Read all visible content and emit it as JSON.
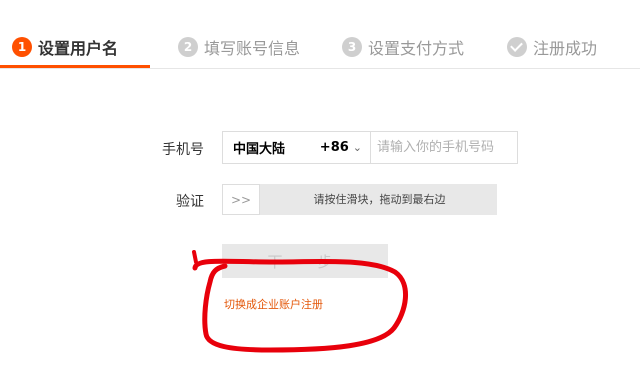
{
  "steps": [
    {
      "num": "1",
      "label": "设置用户名",
      "state": "active"
    },
    {
      "num": "2",
      "label": "填写账号信息",
      "state": "pending"
    },
    {
      "num": "3",
      "label": "设置支付方式",
      "state": "pending"
    },
    {
      "icon": "check-icon",
      "label": "注册成功",
      "state": "pending"
    }
  ],
  "form": {
    "phone_label": "手机号",
    "region": "中国大陆",
    "country_code": "+86",
    "phone_placeholder": "请输入你的手机号码",
    "verify_label": "验证",
    "slider_handle": ">>",
    "slider_text": "请按住滑块，拖动到最右边",
    "next_button": "下一步",
    "enterprise_link": "切换成企业账户注册"
  },
  "colors": {
    "accent": "#ff5000",
    "link": "#e4580b",
    "annotation": "#e8000b"
  }
}
